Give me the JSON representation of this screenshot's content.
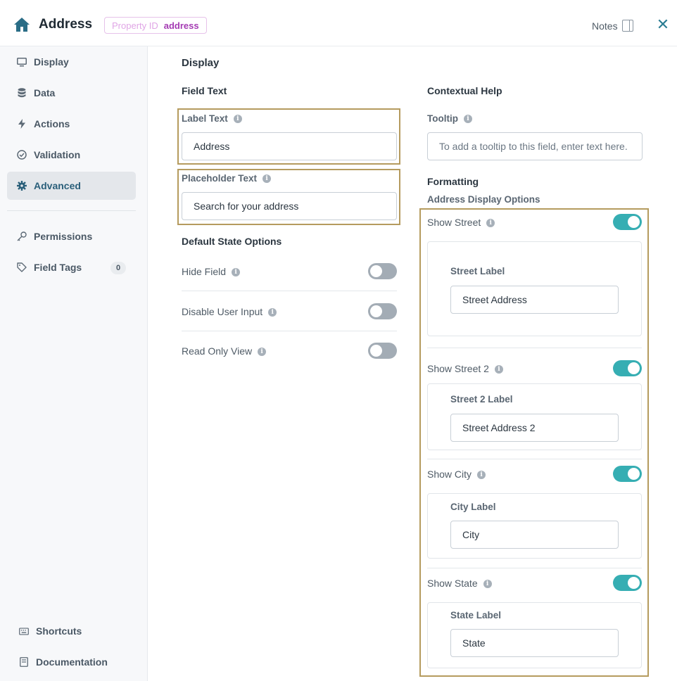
{
  "header": {
    "title": "Address",
    "property_id_key": "Property ID",
    "property_id_value": "address",
    "notes_label": "Notes",
    "close_symbol": "✕"
  },
  "sidebar": {
    "items": [
      {
        "label": "Display",
        "icon": "monitor-icon"
      },
      {
        "label": "Data",
        "icon": "database-icon"
      },
      {
        "label": "Actions",
        "icon": "lightning-icon"
      },
      {
        "label": "Validation",
        "icon": "check-circle-icon"
      },
      {
        "label": "Advanced",
        "icon": "gear-icon",
        "active": true
      },
      {
        "label": "Permissions",
        "icon": "key-icon"
      },
      {
        "label": "Field Tags",
        "icon": "tag-icon",
        "count": "0"
      }
    ],
    "footer": [
      {
        "label": "Shortcuts",
        "icon": "keyboard-icon"
      },
      {
        "label": "Documentation",
        "icon": "book-icon"
      }
    ]
  },
  "main": {
    "section_title": "Display",
    "field_text_heading": "Field Text",
    "label_text": {
      "label": "Label Text",
      "value": "Address"
    },
    "placeholder_text": {
      "label": "Placeholder Text",
      "value": "Search for your address"
    },
    "default_state_heading": "Default State Options",
    "default_state_options": [
      {
        "label": "Hide Field",
        "on": false
      },
      {
        "label": "Disable User Input",
        "on": false
      },
      {
        "label": "Read Only View",
        "on": false
      }
    ],
    "contextual_help_heading": "Contextual Help",
    "tooltip": {
      "label": "Tooltip",
      "placeholder": "To add a tooltip to this field, enter text here."
    },
    "formatting_heading": "Formatting",
    "address_display_heading": "Address Display Options",
    "address_options": [
      {
        "label": "Show Street",
        "on": true,
        "sub_label": "Street Label",
        "sub_value": "Street Address"
      },
      {
        "label": "Show Street 2",
        "on": true,
        "sub_label": "Street 2 Label",
        "sub_value": "Street Address 2"
      },
      {
        "label": "Show City",
        "on": true,
        "sub_label": "City Label",
        "sub_value": "City"
      },
      {
        "label": "Show State",
        "on": true,
        "sub_label": "State Label",
        "sub_value": "State"
      }
    ]
  },
  "colors": {
    "accent": "#36aeb3",
    "highlight_border": "#b59b5e",
    "brand_dark": "#2a5f7a",
    "badge_purple": "#a43bb3"
  }
}
